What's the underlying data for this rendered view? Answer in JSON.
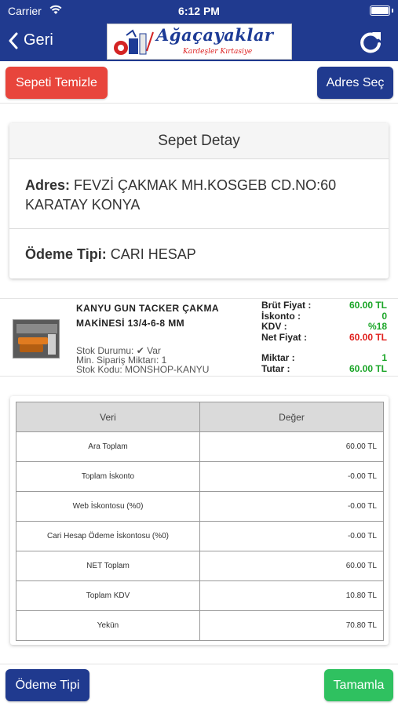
{
  "status_bar": {
    "carrier": "Carrier",
    "time": "6:12 PM"
  },
  "nav": {
    "back_label": "Geri",
    "logo_title": "Ağaçayaklar",
    "logo_subtitle": "Kardeşler Kırtasiye"
  },
  "toolbar": {
    "clear_label": "Sepeti Temizle",
    "address_label": "Adres Seç"
  },
  "detail": {
    "title": "Sepet Detay",
    "address_label": "Adres:",
    "address_value": "FEVZİ ÇAKMAK MH.KOSGEB CD.NO:60 KARATAY KONYA",
    "payment_label": "Ödeme Tipi:",
    "payment_value": "CARI HESAP"
  },
  "product": {
    "name": "KANYU GUN TACKER ÇAKMA MAKİNESİ 13/4-6-8 MM",
    "stock_label": "Stok Durumu:",
    "stock_value": "✔ Var",
    "min_order": "Min. Sipariş Miktarı: 1",
    "stock_code": "Stok Kodu: MONSHOP-KANYU",
    "gross_label": "Brüt Fiyat :",
    "gross_value": "60.00 TL",
    "discount_label": "İskonto :",
    "discount_value": "0",
    "vat_label": "KDV :",
    "vat_value": "%18",
    "net_label": "Net Fiyat :",
    "net_value": "60.00 TL",
    "qty_label": "Miktar :",
    "qty_value": "1",
    "total_label": "Tutar :",
    "total_value": "60.00 TL"
  },
  "summary": {
    "headers": [
      "Veri",
      "Değer"
    ],
    "rows": [
      {
        "key": "Ara Toplam",
        "value": "60.00 TL"
      },
      {
        "key": "Toplam İskonto",
        "value": "-0.00 TL"
      },
      {
        "key": "Web İskontosu (%0)",
        "value": "-0.00 TL"
      },
      {
        "key": "Cari Hesap Ödeme İskontosu (%0)",
        "value": "-0.00 TL"
      },
      {
        "key": "NET Toplam",
        "value": "60.00 TL"
      },
      {
        "key": "Toplam KDV",
        "value": "10.80 TL"
      },
      {
        "key": "Yekün",
        "value": "70.80 TL"
      }
    ]
  },
  "bottom": {
    "payment_label": "Ödeme Tipi",
    "done_label": "Tamamla"
  },
  "colors": {
    "primary": "#203a8f",
    "danger": "#e8453c",
    "success": "#2fc160",
    "price_green": "#1aa527",
    "price_red": "#e0201d"
  },
  "icons": {
    "back": "chevron-left-icon",
    "refresh": "refresh-icon",
    "wifi": "wifi-icon",
    "battery": "battery-icon"
  }
}
